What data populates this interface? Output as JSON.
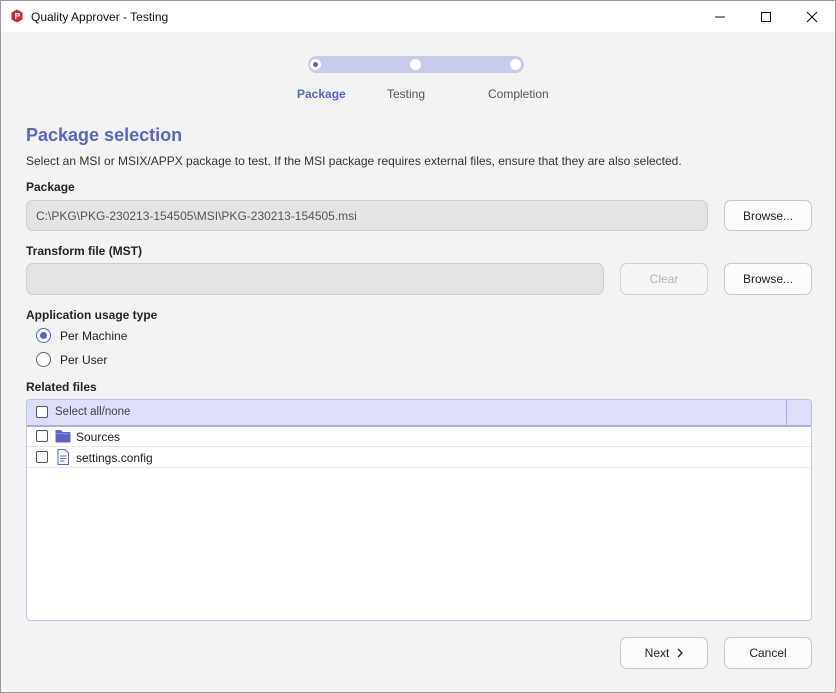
{
  "window": {
    "title": "Quality Approver - Testing",
    "minimize_icon": "minimize-icon",
    "maximize_icon": "maximize-icon",
    "close_icon": "close-icon"
  },
  "stepper": {
    "steps": [
      {
        "label": "Package",
        "active": true
      },
      {
        "label": "Testing",
        "active": false
      },
      {
        "label": "Completion",
        "active": false
      }
    ]
  },
  "page": {
    "heading": "Package selection",
    "description": "Select an MSI or MSIX/APPX package to test. If the MSI package requires external files, ensure that they are also selected."
  },
  "package": {
    "label": "Package",
    "value": "C:\\PKG\\PKG-230213-154505\\MSI\\PKG-230213-154505.msi",
    "browse_label": "Browse..."
  },
  "transform": {
    "label": "Transform file (MST)",
    "value": "",
    "clear_label": "Clear",
    "browse_label": "Browse..."
  },
  "usage": {
    "label": "Application usage type",
    "options": [
      {
        "label": "Per Machine",
        "checked": true
      },
      {
        "label": "Per User",
        "checked": false
      }
    ]
  },
  "related_files": {
    "label": "Related files",
    "select_all_label": "Select all/none",
    "items": [
      {
        "name": "Sources",
        "icon": "folder-icon",
        "checked": false
      },
      {
        "name": "settings.config",
        "icon": "file-icon",
        "checked": false
      }
    ]
  },
  "footer": {
    "next_label": "Next",
    "cancel_label": "Cancel"
  },
  "colors": {
    "accent": "#5b63c8",
    "track": "#c9cbe8",
    "list_header": "#dcdefa"
  }
}
